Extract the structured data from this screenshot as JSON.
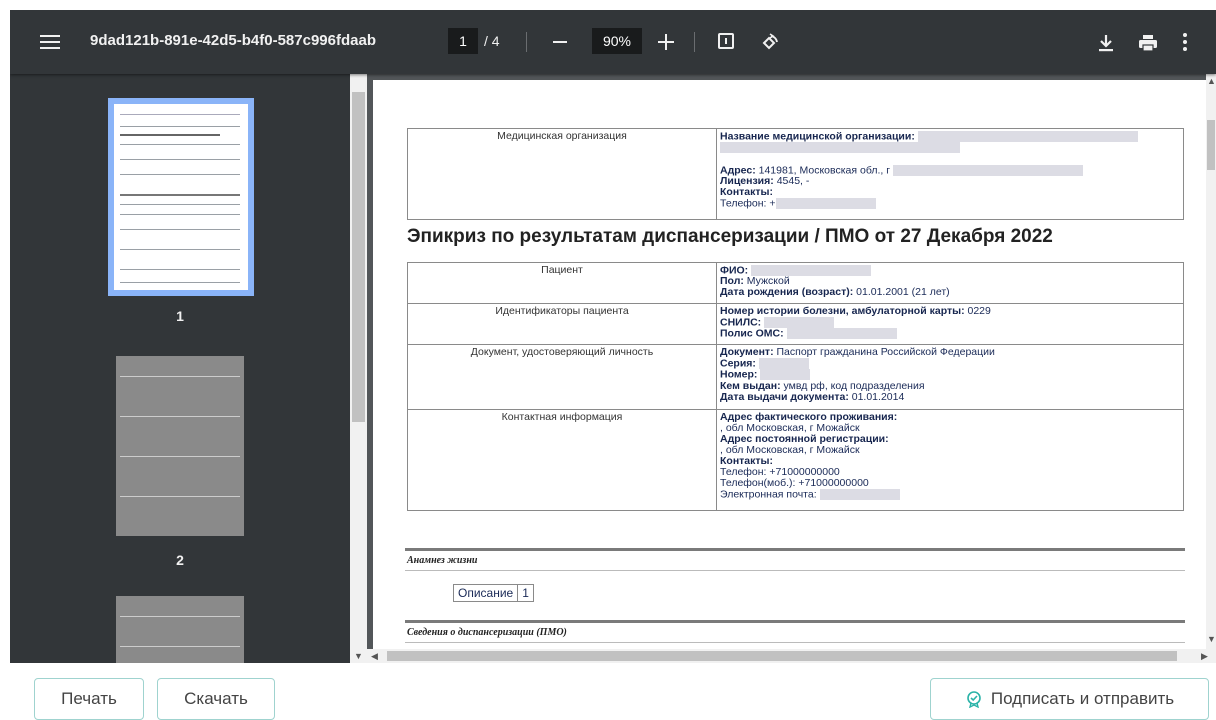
{
  "viewer": {
    "file_name": "9dad121b-891e-42d5-b4f0-587c996fdaab",
    "current_page": "1",
    "page_separator": "/ 4",
    "zoom": "90%"
  },
  "thumbnails": [
    {
      "label": "1"
    },
    {
      "label": "2"
    }
  ],
  "document": {
    "org_label": "Медицинская организация",
    "org_name_key": "Название медицинской организации:",
    "org_address_key": "Адрес:",
    "org_address_val": "141981, Московская обл., г",
    "org_license_key": "Лицензия:",
    "org_license_val": "4545, -",
    "org_contacts_key": "Контакты:",
    "org_phone_key": "Телефон: +",
    "heading": "Эпикриз по результатам диспансеризации / ПМО от 27 Декабря 2022",
    "patient_label": "Пациент",
    "fio_key": "ФИО:",
    "sex_key": "Пол:",
    "sex_val": "Мужской",
    "dob_key": "Дата рождения (возраст):",
    "dob_val": "01.01.2001 (21 лет)",
    "ids_label": "Идентификаторы пациента",
    "history_key": "Номер истории болезни, амбулаторной карты:",
    "history_val": "0229",
    "snils_key": "СНИЛС:",
    "oms_key": "Полис ОМС:",
    "doc_label": "Документ, удостоверяющий личность",
    "doc_key": "Документ:",
    "doc_val": "Паспорт гражданина Российской Федерации",
    "series_key": "Серия:",
    "number_key": "Номер:",
    "issued_key": "Кем выдан:",
    "issued_val": "умвд рф, код подразделения",
    "issue_date_key": "Дата выдачи документа:",
    "issue_date_val": "01.01.2014",
    "contact_label": "Контактная информация",
    "addr_fact_key": "Адрес фактического проживания:",
    "addr_fact_val": ", обл Московская, г Можайск",
    "addr_reg_key": "Адрес постоянной регистрации:",
    "addr_reg_val": ", обл Московская, г Можайск",
    "contacts_key": "Контакты:",
    "phone_line": "Телефон: +71000000000",
    "mobile_line": "Телефон(моб.): +71000000000",
    "email_line": "Электронная почта:",
    "section1_title": "Анамнез жизни",
    "opis_label": "Описание",
    "opis_num": "1",
    "section2_title": "Сведения о диспансеризации (ПМО)"
  },
  "buttons": {
    "print": "Печать",
    "download": "Скачать",
    "sign_send": "Подписать и отправить"
  }
}
